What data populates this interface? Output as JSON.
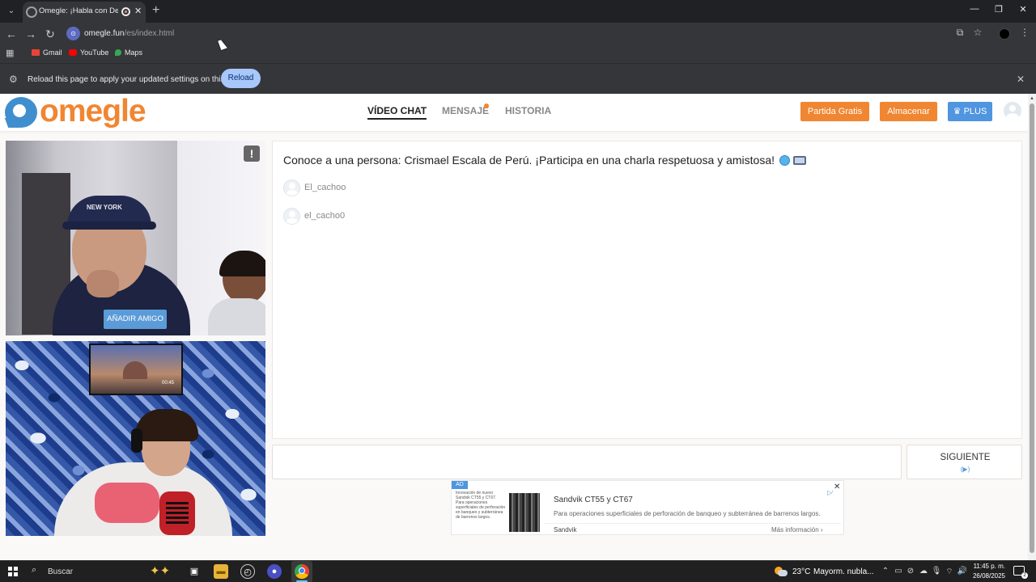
{
  "browser": {
    "tab_title": "Omegle: ¡Habla con Descon",
    "url_host": "omegle.fun",
    "url_path": "/es/index.html",
    "bookmarks": [
      "Gmail",
      "YouTube",
      "Maps"
    ],
    "infobar_text": "Reload this page to apply your updated settings on this site",
    "infobar_button": "Reload"
  },
  "header": {
    "logo_text": "omegle",
    "nav": [
      "VÍDEO CHAT",
      "MENSAJE",
      "HISTORIA"
    ],
    "btn_free_game": "Partida Gratis",
    "btn_store": "Almacenar",
    "btn_plus": "PLUS"
  },
  "videos": {
    "report_label": "!",
    "add_friend": "AÑADIR AMIGO",
    "cap_text": "NEW YORK",
    "tv_time": "00:45"
  },
  "chat": {
    "intro": "Conoce a una persona: Crismael Escala de Perú. ¡Participa en una charla respetuosa y amistosa!",
    "users": [
      "El_cachoo",
      "el_cacho0"
    ],
    "input_value": "",
    "next_label": "SIGUIENTE",
    "next_hint": "(▶)"
  },
  "ad": {
    "badge": "AD",
    "thumb_text": "Innovación de nuevo Sandvik CT55 y CT67. Para operaciones superficiales de perforación en banqueo y subterránea de barrenos largos.",
    "title": "Sandvik CT55 y CT67",
    "description": "Para operaciones superficiales de perforación de banqueo y subterránea de barrenos largos.",
    "brand": "Sandvik",
    "cta": "Más información"
  },
  "taskbar": {
    "search": "Buscar",
    "temp": "23°C",
    "weather": "Mayorm. nubla...",
    "time": "11:45 p. m.",
    "date": "26/08/2025"
  },
  "colors": {
    "brand_orange": "#f08631",
    "brand_blue": "#3f8fcf",
    "plus_blue": "#4f95e0"
  }
}
